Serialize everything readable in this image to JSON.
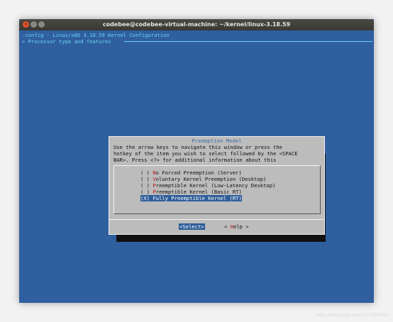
{
  "window": {
    "title": "codebee@codebee-virtual-machine: ~/kernel/linux-3.18.59",
    "buttons": {
      "close": "×",
      "minimize": "",
      "maximize": ""
    }
  },
  "terminal": {
    "line1": ".config - Linux/x86 3.18.59 Kernel Configuration",
    "line2": "> Processor type and features"
  },
  "dialog": {
    "title": "Preemption Model",
    "help_lines": [
      "Use the arrow keys to navigate this window or press the",
      "hotkey of the item you wish to select followed by the <SPACE",
      "BAR>. Press <?> for additional information about this"
    ],
    "options": [
      {
        "mark": "( )",
        "hotkey": "N",
        "rest": "o Forced Preemption (Server)",
        "selected": false
      },
      {
        "mark": "( )",
        "hotkey": "V",
        "rest": "oluntary Kernel Preemption (Desktop)",
        "selected": false
      },
      {
        "mark": "( )",
        "hotkey": "P",
        "rest": "reemptible Kernel (Low-Latency Desktop)",
        "selected": false
      },
      {
        "mark": "( )",
        "hotkey": "P",
        "rest": "reemptible Kernel (Basic RT)",
        "selected": false
      },
      {
        "mark": "(X)",
        "hotkey": "F",
        "rest": "ully Preemptible Kernel (RT)",
        "selected": true
      }
    ],
    "buttons": {
      "select": "<Select>",
      "help_prefix": "< ",
      "help_hotkey": "H",
      "help_rest": "elp >"
    }
  },
  "watermark": "http://blog.csdn.net/u011350803/"
}
